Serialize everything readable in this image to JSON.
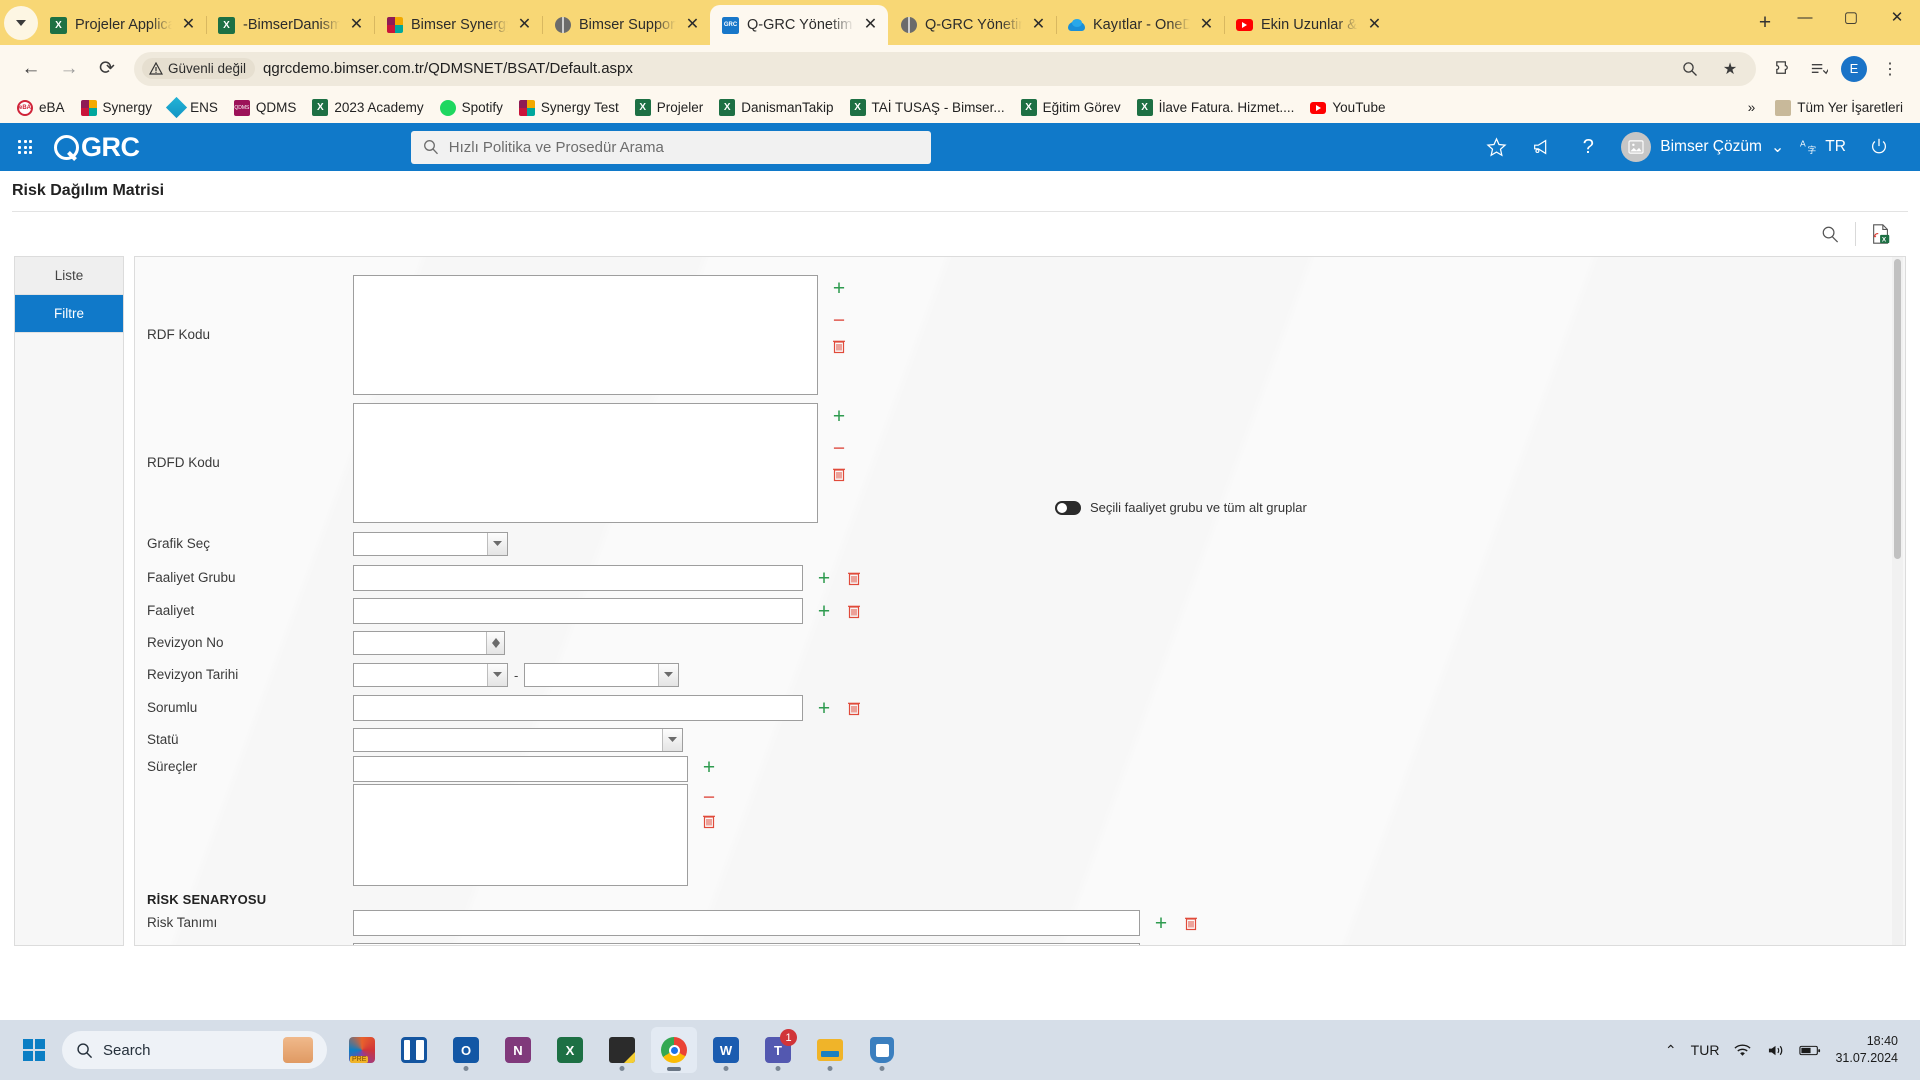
{
  "browser": {
    "tabs": [
      {
        "title": "Projeler Applicati",
        "icon": "excel-icon",
        "active": false
      },
      {
        "title": "-BimserDanisman",
        "icon": "excel-icon",
        "active": false
      },
      {
        "title": "Bimser Synergy",
        "icon": "bimser-icon",
        "active": false
      },
      {
        "title": "Bimser Support S",
        "icon": "globe-icon",
        "active": false
      },
      {
        "title": "Q-GRC Yönetim S",
        "icon": "qgrc-icon",
        "active": true
      },
      {
        "title": "Q-GRC Yönetim S",
        "icon": "globe-icon",
        "active": false
      },
      {
        "title": "Kayıtlar - OneDri",
        "icon": "onedrive-icon",
        "active": false
      },
      {
        "title": "Ekin Uzunlar & K",
        "icon": "youtube-icon",
        "active": false
      }
    ],
    "tab_close_label": "✕",
    "new_tab_label": "+",
    "window_controls": {
      "minimize": "—",
      "maximize": "▢",
      "close": "✕"
    },
    "nav": {
      "back": "←",
      "forward": "→",
      "reload": "⟳"
    },
    "security_label": "Güvenli değil",
    "url": "qgrcdemo.bimser.com.tr/QDMSNET/BSAT/Default.aspx",
    "toolbar_icons": {
      "zoom": "search-plus-icon",
      "bookmark_star": "★",
      "extensions": "puzzle-icon",
      "reading_list": "list-icon",
      "menu": "⋮",
      "profile_initial": "E"
    },
    "bookmarks": [
      {
        "label": "eBA",
        "icon": "eba-icon"
      },
      {
        "label": "Synergy",
        "icon": "bimser-icon"
      },
      {
        "label": "ENS",
        "icon": "ens-icon"
      },
      {
        "label": "QDMS",
        "icon": "qdms-icon"
      },
      {
        "label": "2023 Academy",
        "icon": "excel-icon"
      },
      {
        "label": "Spotify",
        "icon": "spotify-icon"
      },
      {
        "label": "Synergy Test",
        "icon": "bimser-icon"
      },
      {
        "label": "Projeler",
        "icon": "excel-icon"
      },
      {
        "label": "DanismanTakip",
        "icon": "excel-icon"
      },
      {
        "label": "TAİ TUSAŞ - Bimser...",
        "icon": "excel-icon"
      },
      {
        "label": "Eğitim Görev",
        "icon": "excel-icon"
      },
      {
        "label": "İlave Fatura. Hizmet....",
        "icon": "excel-icon"
      },
      {
        "label": "YouTube",
        "icon": "youtube-icon"
      }
    ],
    "bookmarks_overflow": "»",
    "all_bookmarks_label": "Tüm Yer İşaretleri"
  },
  "app": {
    "brand": "GRC",
    "apps_grid_icon": "apps-grid-icon",
    "search_placeholder": "Hızlı Politika ve Prosedür Arama",
    "header_icons": {
      "favorites": "star-icon",
      "announcements": "megaphone-icon",
      "help": "?",
      "power": "power-icon"
    },
    "user_name": "Bimser Çözüm",
    "user_chevron": "⌄",
    "language": "TR",
    "language_icon": "translate-icon",
    "accent_color": "#1079c9",
    "page_title": "Risk Dağılım Matrisi",
    "action_icons": {
      "search": "search-icon",
      "export_excel": "export-excel-icon"
    },
    "side_tabs": [
      {
        "label": "Liste",
        "active": false
      },
      {
        "label": "Filtre",
        "active": true
      }
    ],
    "form": {
      "fields": [
        {
          "label": "RDF Kodu"
        },
        {
          "label": "RDFD Kodu"
        },
        {
          "label": "Grafik Seç"
        },
        {
          "label": "Faaliyet Grubu"
        },
        {
          "label": "Faaliyet"
        },
        {
          "label": "Revizyon No"
        },
        {
          "label": "Revizyon Tarihi"
        },
        {
          "label": "Sorumlu"
        },
        {
          "label": "Statü"
        },
        {
          "label": "Süreçler"
        },
        {
          "label": "Risk Tanımı"
        }
      ],
      "date_separator": "-",
      "section_header": "RİSK SENARYOSU",
      "toggle_label": "Seçili faaliyet grubu ve tüm alt gruplar",
      "toggle_state": "off",
      "buttons": {
        "add": "+",
        "remove": "−",
        "delete": "delete-icon"
      }
    }
  },
  "taskbar": {
    "start_label": "start-icon",
    "search_placeholder": "Search",
    "apps": [
      {
        "name": "bowling-widget-icon",
        "running": false
      },
      {
        "name": "powerpoint-icon",
        "running": false
      },
      {
        "name": "teams-grid-icon",
        "running": false
      },
      {
        "name": "outlook-icon",
        "running": true
      },
      {
        "name": "onenote-icon",
        "running": false
      },
      {
        "name": "excel-icon",
        "running": false
      },
      {
        "name": "sticky-notes-icon",
        "running": true
      },
      {
        "name": "chrome-icon",
        "running": true,
        "active": true
      },
      {
        "name": "word-icon",
        "running": true
      },
      {
        "name": "teams-icon",
        "running": true,
        "badge": "1"
      },
      {
        "name": "file-explorer-icon",
        "running": true
      },
      {
        "name": "security-icon",
        "running": true
      }
    ],
    "tray": {
      "chevron": "⌃",
      "language": "TUR",
      "wifi": "wifi-icon",
      "volume": "volume-icon",
      "battery": "battery-icon",
      "time": "18:40",
      "date": "31.07.2024"
    }
  }
}
